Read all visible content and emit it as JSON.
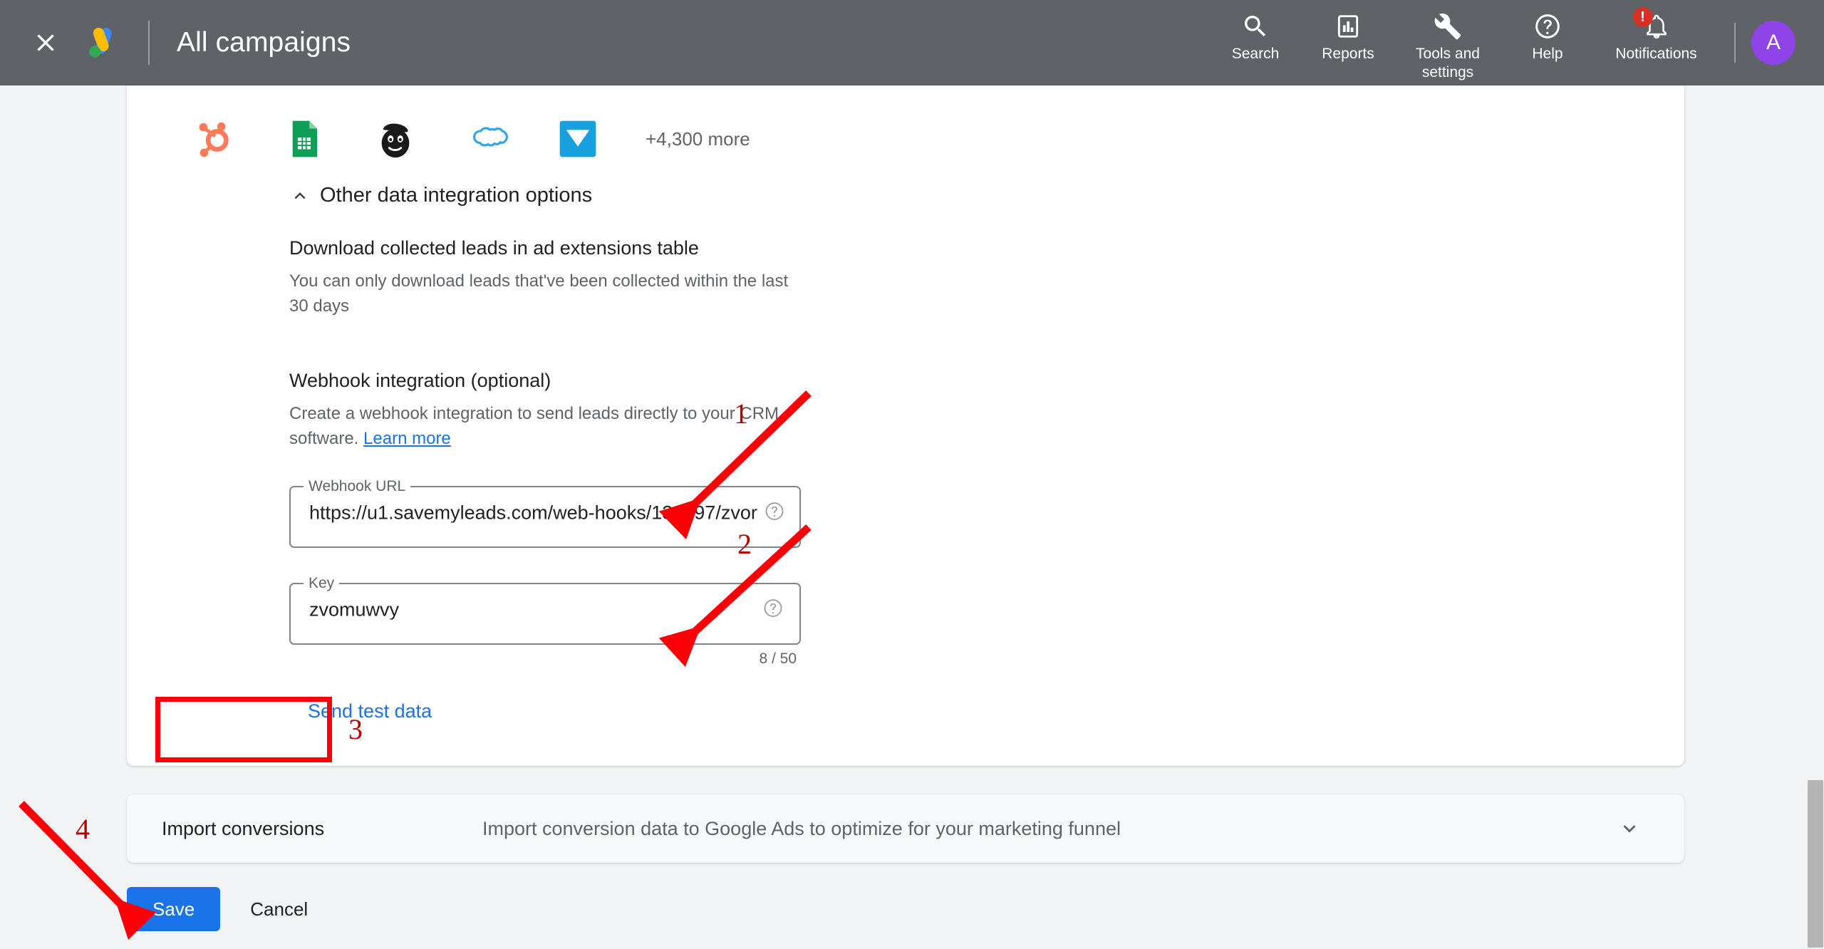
{
  "topbar": {
    "close_icon": "close-icon",
    "logo": "google-ads-logo",
    "title": "All campaigns",
    "nav": [
      {
        "label": "Search",
        "icon": "search-icon"
      },
      {
        "label": "Reports",
        "icon": "reports-bar-chart-icon"
      },
      {
        "label": "Tools and\nsettings",
        "icon": "wrench-icon"
      },
      {
        "label": "Help",
        "icon": "help-question-icon"
      },
      {
        "label": "Notifications",
        "icon": "bell-icon",
        "badge": "!"
      }
    ],
    "avatar_initial": "A"
  },
  "integrations": {
    "icons": [
      "hubspot-icon",
      "google-sheets-icon",
      "mailchimp-icon",
      "salesforce-icon",
      "campaign-monitor-icon"
    ],
    "more_label": "+4,300 more"
  },
  "collapse": {
    "icon": "chevron-up-icon",
    "title": "Other data integration options"
  },
  "download_section": {
    "title": "Download collected leads in ad extensions table",
    "description": "You can only download leads that've been collected within the last 30 days"
  },
  "webhook": {
    "title": "Webhook integration (optional)",
    "description": "Create a webhook integration to send leads directly to your CRM software.",
    "learn_more": "Learn more",
    "url_field": {
      "label": "Webhook URL",
      "value": "https://u1.savemyleads.com/web-hooks/131897/zvor",
      "help_icon": "help-circle-icon"
    },
    "key_field": {
      "label": "Key",
      "value": "zvomuwvy",
      "help_icon": "help-circle-icon",
      "counter": "8 / 50"
    },
    "send_test_label": "Send test data"
  },
  "import_conversions": {
    "label": "Import conversions",
    "description": "Import conversion data to Google Ads to optimize for your marketing funnel",
    "chevron_icon": "chevron-down-icon"
  },
  "actions": {
    "save_label": "Save",
    "cancel_label": "Cancel"
  },
  "annotations": {
    "one": "1",
    "two": "2",
    "three": "3",
    "four": "4"
  },
  "colors": {
    "topbar": "#5f6368",
    "page_bg": "#f1f3f4",
    "accent_blue": "#1a73e8",
    "annotation_red": "#fb0007",
    "annotation_number_red": "#b30000",
    "avatar_purple": "#8e44e8"
  }
}
